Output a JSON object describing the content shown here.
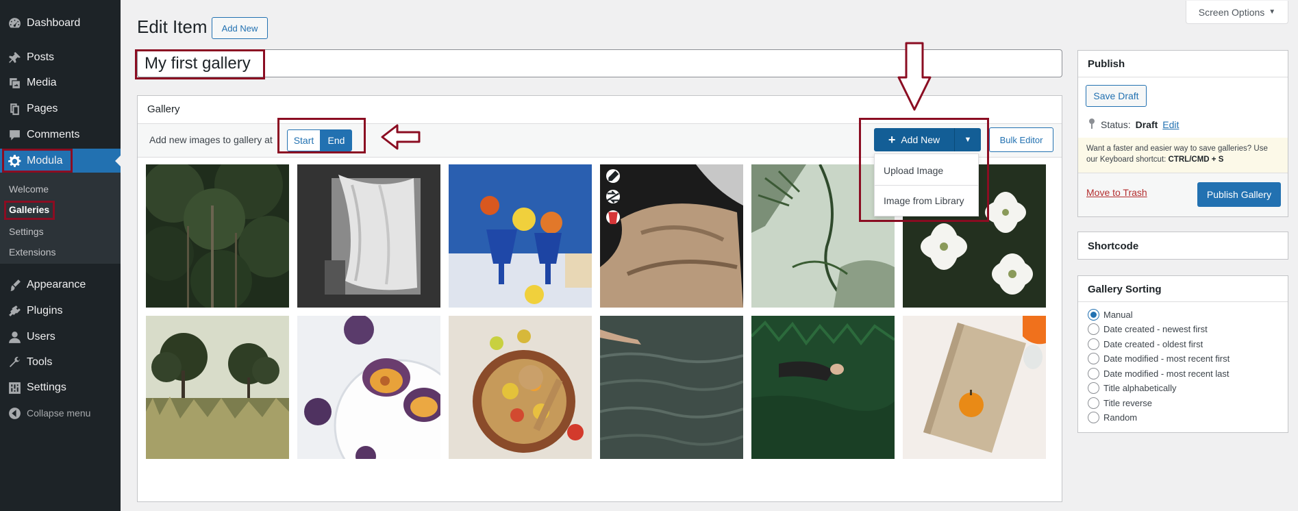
{
  "sidebar": {
    "items": [
      {
        "label": "Dashboard",
        "icon": "dashboard-icon"
      },
      {
        "label": "Posts",
        "icon": "pin-icon"
      },
      {
        "label": "Media",
        "icon": "media-icon"
      },
      {
        "label": "Pages",
        "icon": "pages-icon"
      },
      {
        "label": "Comments",
        "icon": "comment-icon"
      },
      {
        "label": "Modula",
        "icon": "gear-icon"
      },
      {
        "label": "Appearance",
        "icon": "brush-icon"
      },
      {
        "label": "Plugins",
        "icon": "plug-icon"
      },
      {
        "label": "Users",
        "icon": "user-icon"
      },
      {
        "label": "Tools",
        "icon": "wrench-icon"
      },
      {
        "label": "Settings",
        "icon": "sliders-icon"
      }
    ],
    "submenu": [
      "Welcome",
      "Galleries",
      "Settings",
      "Extensions"
    ],
    "collapse_label": "Collapse menu"
  },
  "header": {
    "title": "Edit Item",
    "add_new_label": "Add New",
    "screen_options_label": "Screen Options"
  },
  "post_title": "My first gallery",
  "gallery": {
    "heading": "Gallery",
    "add_at_label": "Add new images to gallery at",
    "start_label": "Start",
    "end_label": "End",
    "add_new_label": "Add New",
    "bulk_editor_label": "Bulk Editor",
    "dropdown": [
      "Upload Image",
      "Image from Library"
    ],
    "images": [
      "forest-image",
      "curtain-image",
      "blue-glasses-fruit-image",
      "bedsheet-image",
      "palm-shadow-image",
      "white-flowers-image",
      "grass-trees-image",
      "plums-image",
      "fruit-bowl-image",
      "water-hand-image",
      "person-in-grass-image",
      "book-orange-image"
    ]
  },
  "publish": {
    "title": "Publish",
    "save_draft_label": "Save Draft",
    "status_label": "Status:",
    "status_value": "Draft",
    "status_edit_label": "Edit",
    "hint_text": "Want a faster and easier way to save galleries? Use our Keyboard shortcut:",
    "hint_shortcut": "CTRL/CMD + S",
    "trash_label": "Move to Trash",
    "publish_label": "Publish Gallery"
  },
  "shortcode": {
    "title": "Shortcode"
  },
  "sorting": {
    "title": "Gallery Sorting",
    "selected": "Manual",
    "options": [
      "Manual",
      "Date created - newest first",
      "Date created - oldest first",
      "Date modified - most recent first",
      "Date modified - most recent last",
      "Title alphabetically",
      "Title reverse",
      "Random"
    ]
  },
  "colors": {
    "sidebar": "#1d2327",
    "accent": "#2271b1",
    "highlight_annotation": "#8b0d22",
    "danger": "#b32d2e"
  }
}
